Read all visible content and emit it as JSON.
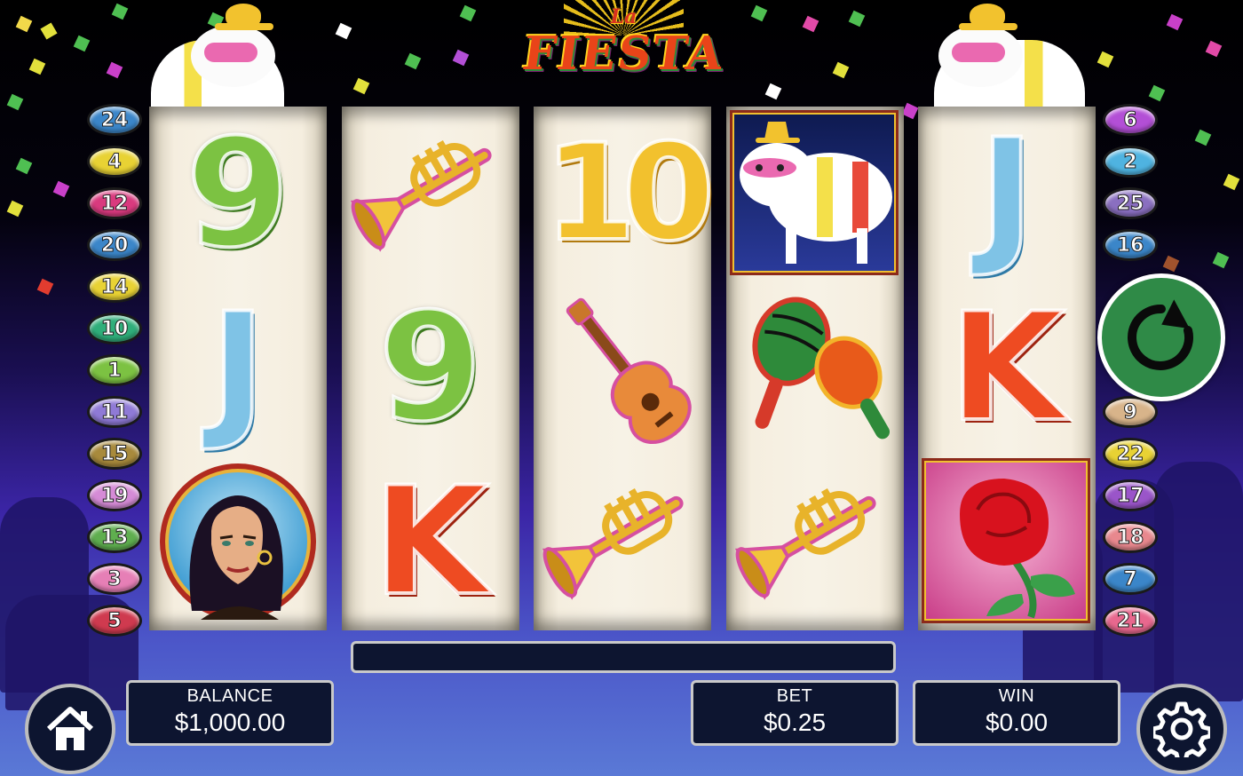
{
  "game": {
    "title_small": "La",
    "title_big": "FIESTA"
  },
  "paylines_left": [
    {
      "label": "24",
      "color": "#3b86c9"
    },
    {
      "label": "4",
      "color": "#e8d234"
    },
    {
      "label": "12",
      "color": "#d93a7e"
    },
    {
      "label": "20",
      "color": "#3b86c9"
    },
    {
      "label": "14",
      "color": "#e8d234"
    },
    {
      "label": "10",
      "color": "#2fae7a"
    },
    {
      "label": "1",
      "color": "#7cc242"
    },
    {
      "label": "11",
      "color": "#8f7ad6"
    },
    {
      "label": "15",
      "color": "#a88a3c"
    },
    {
      "label": "19",
      "color": "#d58bd6"
    },
    {
      "label": "13",
      "color": "#5fae4f"
    },
    {
      "label": "3",
      "color": "#e67fb6"
    },
    {
      "label": "5",
      "color": "#cf3a4f"
    }
  ],
  "paylines_right": [
    {
      "label": "6",
      "color": "#b34fd6"
    },
    {
      "label": "2",
      "color": "#4fb3e0"
    },
    {
      "label": "25",
      "color": "#8a6fc0"
    },
    {
      "label": "16",
      "color": "#3b86c9"
    },
    {
      "label": "9",
      "color": "#d8b48a"
    },
    {
      "label": "22",
      "color": "#e8d234"
    },
    {
      "label": "17",
      "color": "#9a55c9"
    },
    {
      "label": "18",
      "color": "#e8888e"
    },
    {
      "label": "7",
      "color": "#3b86c9"
    },
    {
      "label": "21",
      "color": "#e8688e"
    }
  ],
  "reels": [
    {
      "cells": [
        {
          "symbol": "9"
        },
        {
          "symbol": "J"
        },
        {
          "symbol": "woman-portrait"
        }
      ]
    },
    {
      "cells": [
        {
          "symbol": "trumpet"
        },
        {
          "symbol": "9"
        },
        {
          "symbol": "K"
        }
      ]
    },
    {
      "cells": [
        {
          "symbol": "10"
        },
        {
          "symbol": "guitar"
        },
        {
          "symbol": "trumpet"
        }
      ]
    },
    {
      "cells": [
        {
          "symbol": "pinata"
        },
        {
          "symbol": "maracas"
        },
        {
          "symbol": "trumpet"
        }
      ]
    },
    {
      "cells": [
        {
          "symbol": "J"
        },
        {
          "symbol": "K"
        },
        {
          "symbol": "rose"
        }
      ]
    }
  ],
  "message": "",
  "balance": {
    "label": "BALANCE",
    "value": "$1,000.00"
  },
  "bet": {
    "label": "BET",
    "value": "$0.25"
  },
  "win": {
    "label": "WIN",
    "value": "$0.00"
  },
  "icons": {
    "home": "home-icon",
    "settings": "gear-icon",
    "spin": "spin-icon"
  },
  "colors": {
    "spin_button": "#2f8a47",
    "panel_bg": "#0d1530"
  }
}
